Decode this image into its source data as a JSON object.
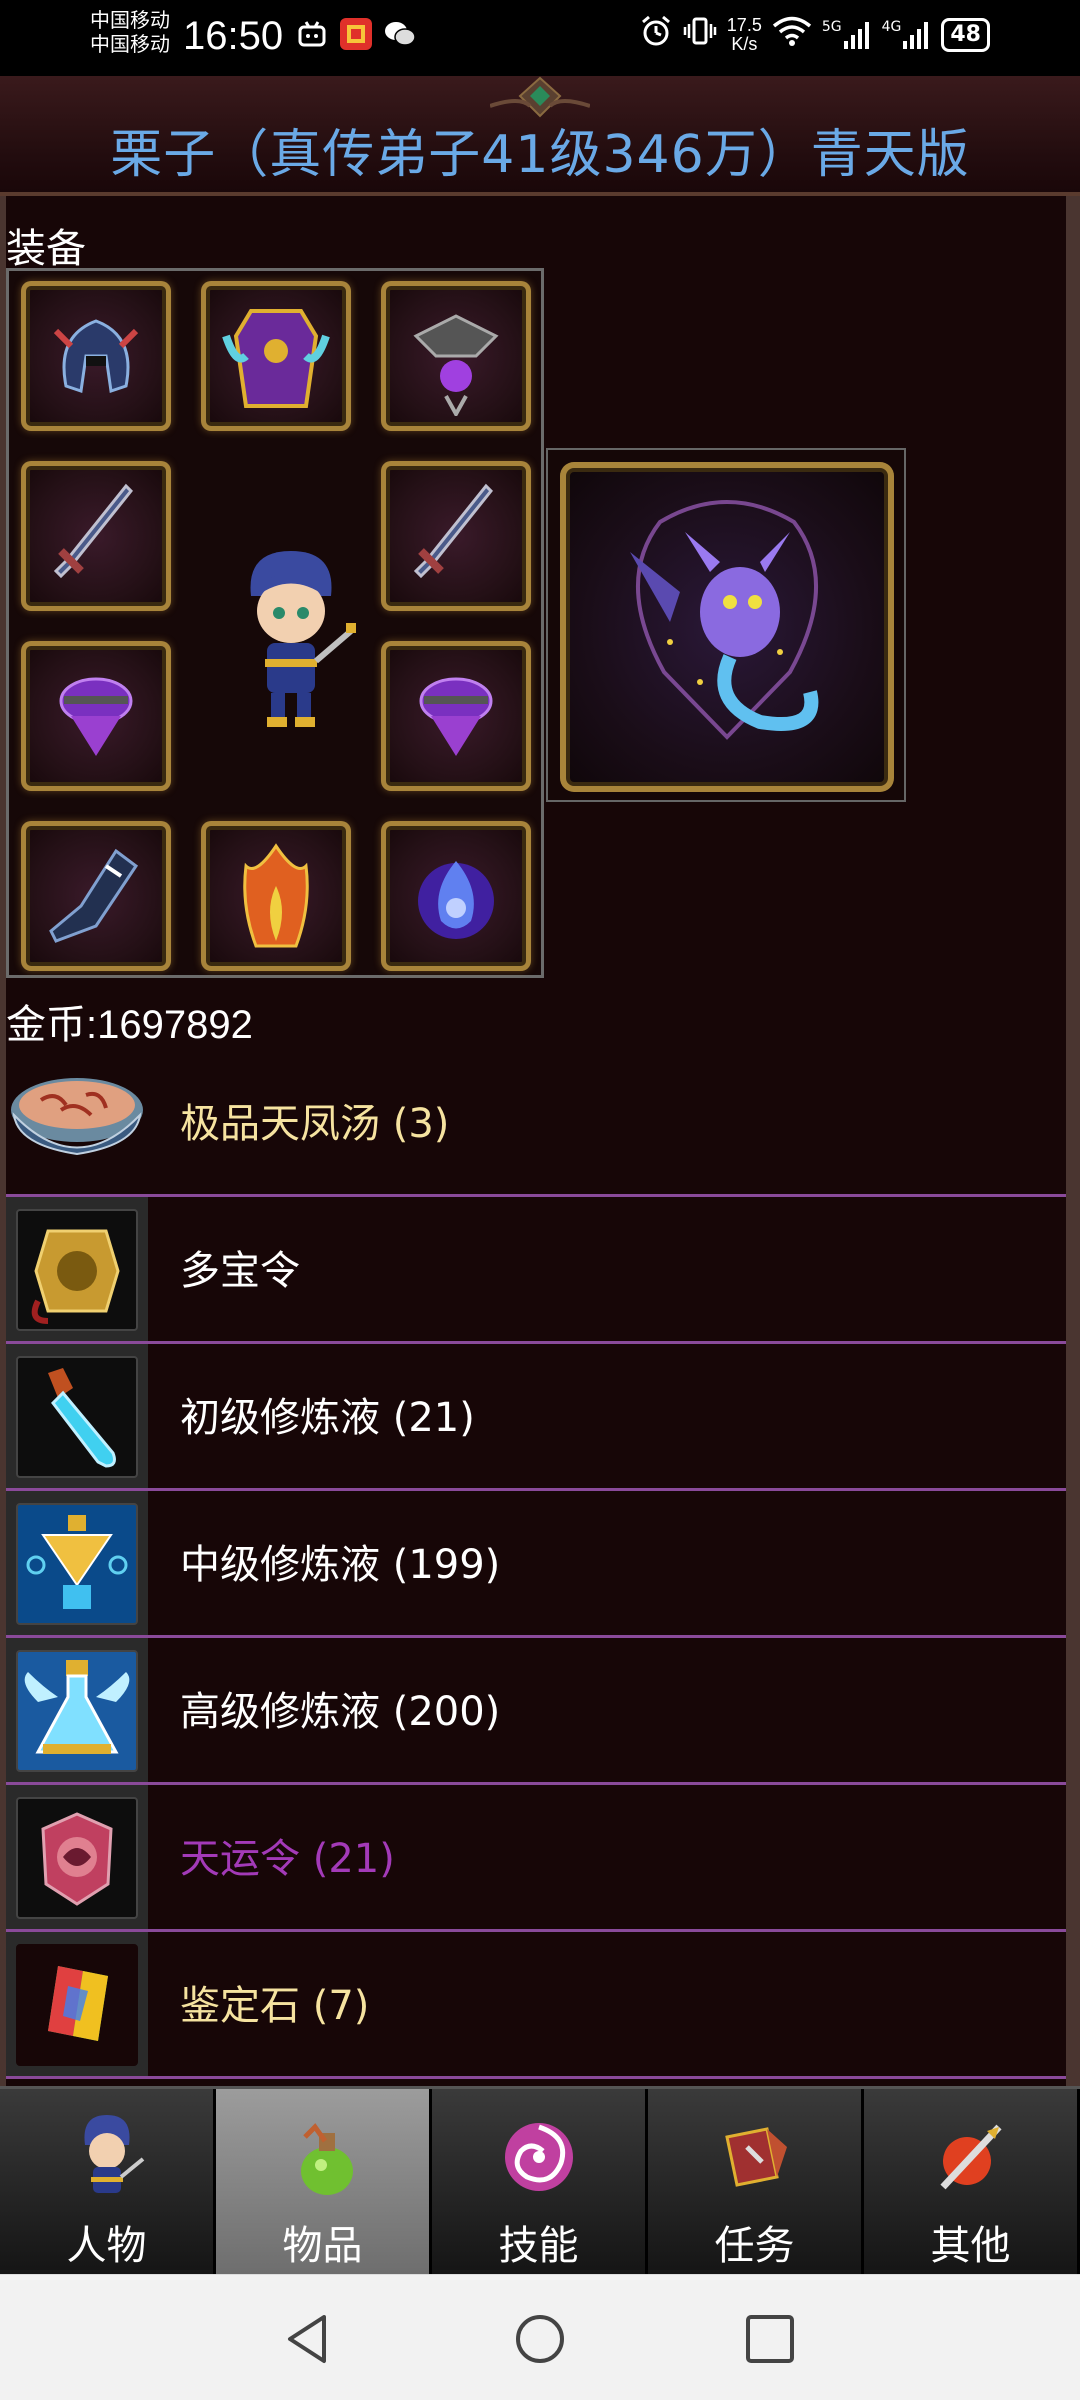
{
  "status_bar": {
    "carrier_1": "中国移动",
    "carrier_2": "中国移动",
    "time": "16:50",
    "net_speed_value": "17.5",
    "net_speed_unit": "K/s",
    "signal_1_label": "5G",
    "signal_2_label": "4G",
    "battery": "48",
    "left_icons": [
      "bilibili-icon",
      "app-badge-icon",
      "wechat-icon"
    ],
    "right_icons": [
      "alarm-icon",
      "vibrate-icon",
      "wifi-icon",
      "signal-5g-icon",
      "signal-4g-icon"
    ]
  },
  "header": {
    "title": "栗子（真传弟子41级346万）青天版"
  },
  "equipment": {
    "section_label": "装备",
    "slots": [
      "helmet",
      "armor",
      "amulet",
      "weapon-left",
      "weapon-right",
      "bracer-left",
      "bracer-right",
      "belt",
      "boots",
      "orb"
    ],
    "pet_slot": "pet"
  },
  "gold": {
    "text": "金币:1697892"
  },
  "items": [
    {
      "name": "极品天凤汤 (3)",
      "color": "#f6e3a0",
      "icon": "soup-bowl-icon"
    },
    {
      "name": "多宝令",
      "color": "#ffffff",
      "icon": "treasure-token-icon"
    },
    {
      "name": "初级修炼液 (21)",
      "color": "#ffffff",
      "icon": "vial-icon"
    },
    {
      "name": "中级修炼液 (199)",
      "color": "#ffffff",
      "icon": "elixir-flask-icon"
    },
    {
      "name": "高级修炼液 (200)",
      "color": "#ffffff",
      "icon": "winged-flask-icon"
    },
    {
      "name": "天运令 (21)",
      "color": "#a33ab8",
      "icon": "fate-token-icon"
    },
    {
      "name": "鉴定石 (7)",
      "color": "#f6e3a0",
      "icon": "identify-gem-icon"
    }
  ],
  "tabs": [
    {
      "label": "人物",
      "icon": "character-icon",
      "active": false
    },
    {
      "label": "物品",
      "icon": "potion-bag-icon",
      "active": true
    },
    {
      "label": "技能",
      "icon": "skill-swirl-icon",
      "active": false
    },
    {
      "label": "任务",
      "icon": "quest-flag-icon",
      "active": false
    },
    {
      "label": "其他",
      "icon": "other-sword-icon",
      "active": false
    }
  ],
  "navbar": [
    "back-icon",
    "home-icon",
    "recents-icon"
  ],
  "colors": {
    "title": "#6aa9e6",
    "panel_bg": "#170607",
    "row_divider": "#8a4a9a",
    "slot_gold": "#a8843a"
  }
}
